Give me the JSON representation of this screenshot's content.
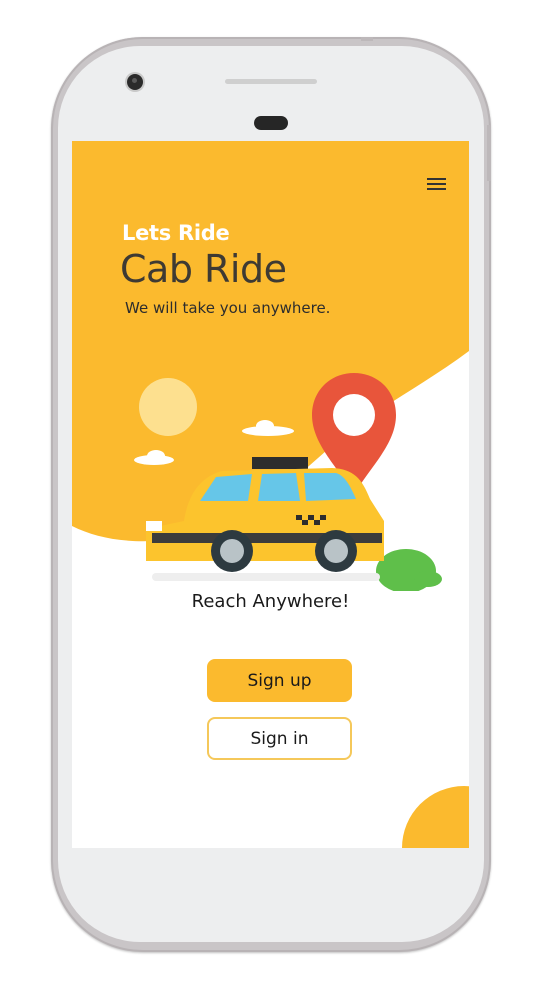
{
  "colors": {
    "accent": "#fbba2e",
    "title_dark": "#3e3a33",
    "pin": "#e8553b",
    "taxi": "#fcc42d",
    "sun": "#fde08f",
    "bush": "#5fbf4a"
  },
  "header": {
    "menu_icon": "hamburger-menu-icon",
    "subtitle": "Lets Ride",
    "title": "Cab Ride",
    "tagline": "We will take you anywhere."
  },
  "hero": {
    "illustration": "taxi-car-with-location-pin"
  },
  "main": {
    "heading": "Reach Anywhere!",
    "signup_label": "Sign up",
    "signin_label": "Sign in"
  }
}
